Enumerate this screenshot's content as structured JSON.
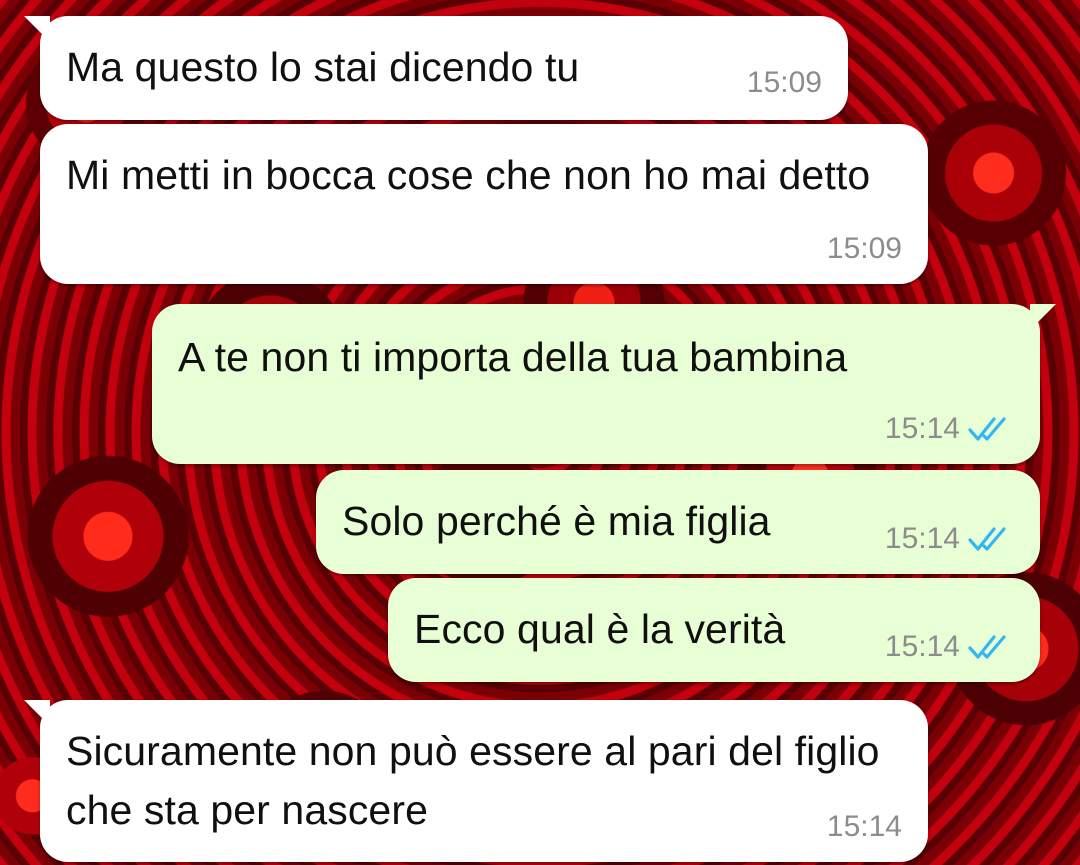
{
  "colors": {
    "incoming_bubble": "#ffffff",
    "outgoing_bubble": "#e8ffd6",
    "read_check": "#34b7f1",
    "timestamp": "#8c8c8c",
    "wallpaper": "red roses"
  },
  "messages": [
    {
      "direction": "incoming",
      "text": "Ma questo lo stai dicendo tu",
      "time": "15:09"
    },
    {
      "direction": "incoming",
      "text": "Mi metti in bocca cose che non ho mai detto",
      "time": "15:09"
    },
    {
      "direction": "outgoing",
      "text": "A te non ti importa della tua bambina",
      "time": "15:14",
      "status": "read"
    },
    {
      "direction": "outgoing",
      "text": "Solo perché è mia figlia",
      "time": "15:14",
      "status": "read"
    },
    {
      "direction": "outgoing",
      "text": "Ecco qual è la verità",
      "time": "15:14",
      "status": "read"
    },
    {
      "direction": "incoming",
      "text": "Sicuramente non può essere al pari del figlio che sta per nascere",
      "time": "15:14"
    }
  ]
}
